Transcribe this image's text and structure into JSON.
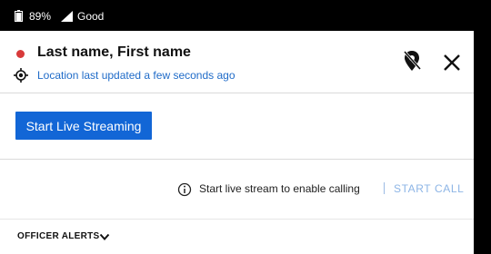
{
  "status_bar": {
    "battery_icon": "battery-icon",
    "battery": "89%",
    "signal_icon": "signal-icon",
    "signal": "Good"
  },
  "header": {
    "status_color": "#d83a3a",
    "name": "Last name, First name",
    "location_icon": "gps-target-icon",
    "location_status": "Location last updated a few seconds ago",
    "pin_off_icon": "location-pin-off-icon",
    "close_icon": "close-icon"
  },
  "stream": {
    "start_label": "Start Live Streaming",
    "accent_color": "#1266d6"
  },
  "call": {
    "info_icon": "info-icon",
    "hint": "Start live stream to enable calling",
    "start_call_label": "START CALL"
  },
  "alerts": {
    "label": "OFFICER ALERTS",
    "chevron_icon": "chevron-down-icon"
  }
}
